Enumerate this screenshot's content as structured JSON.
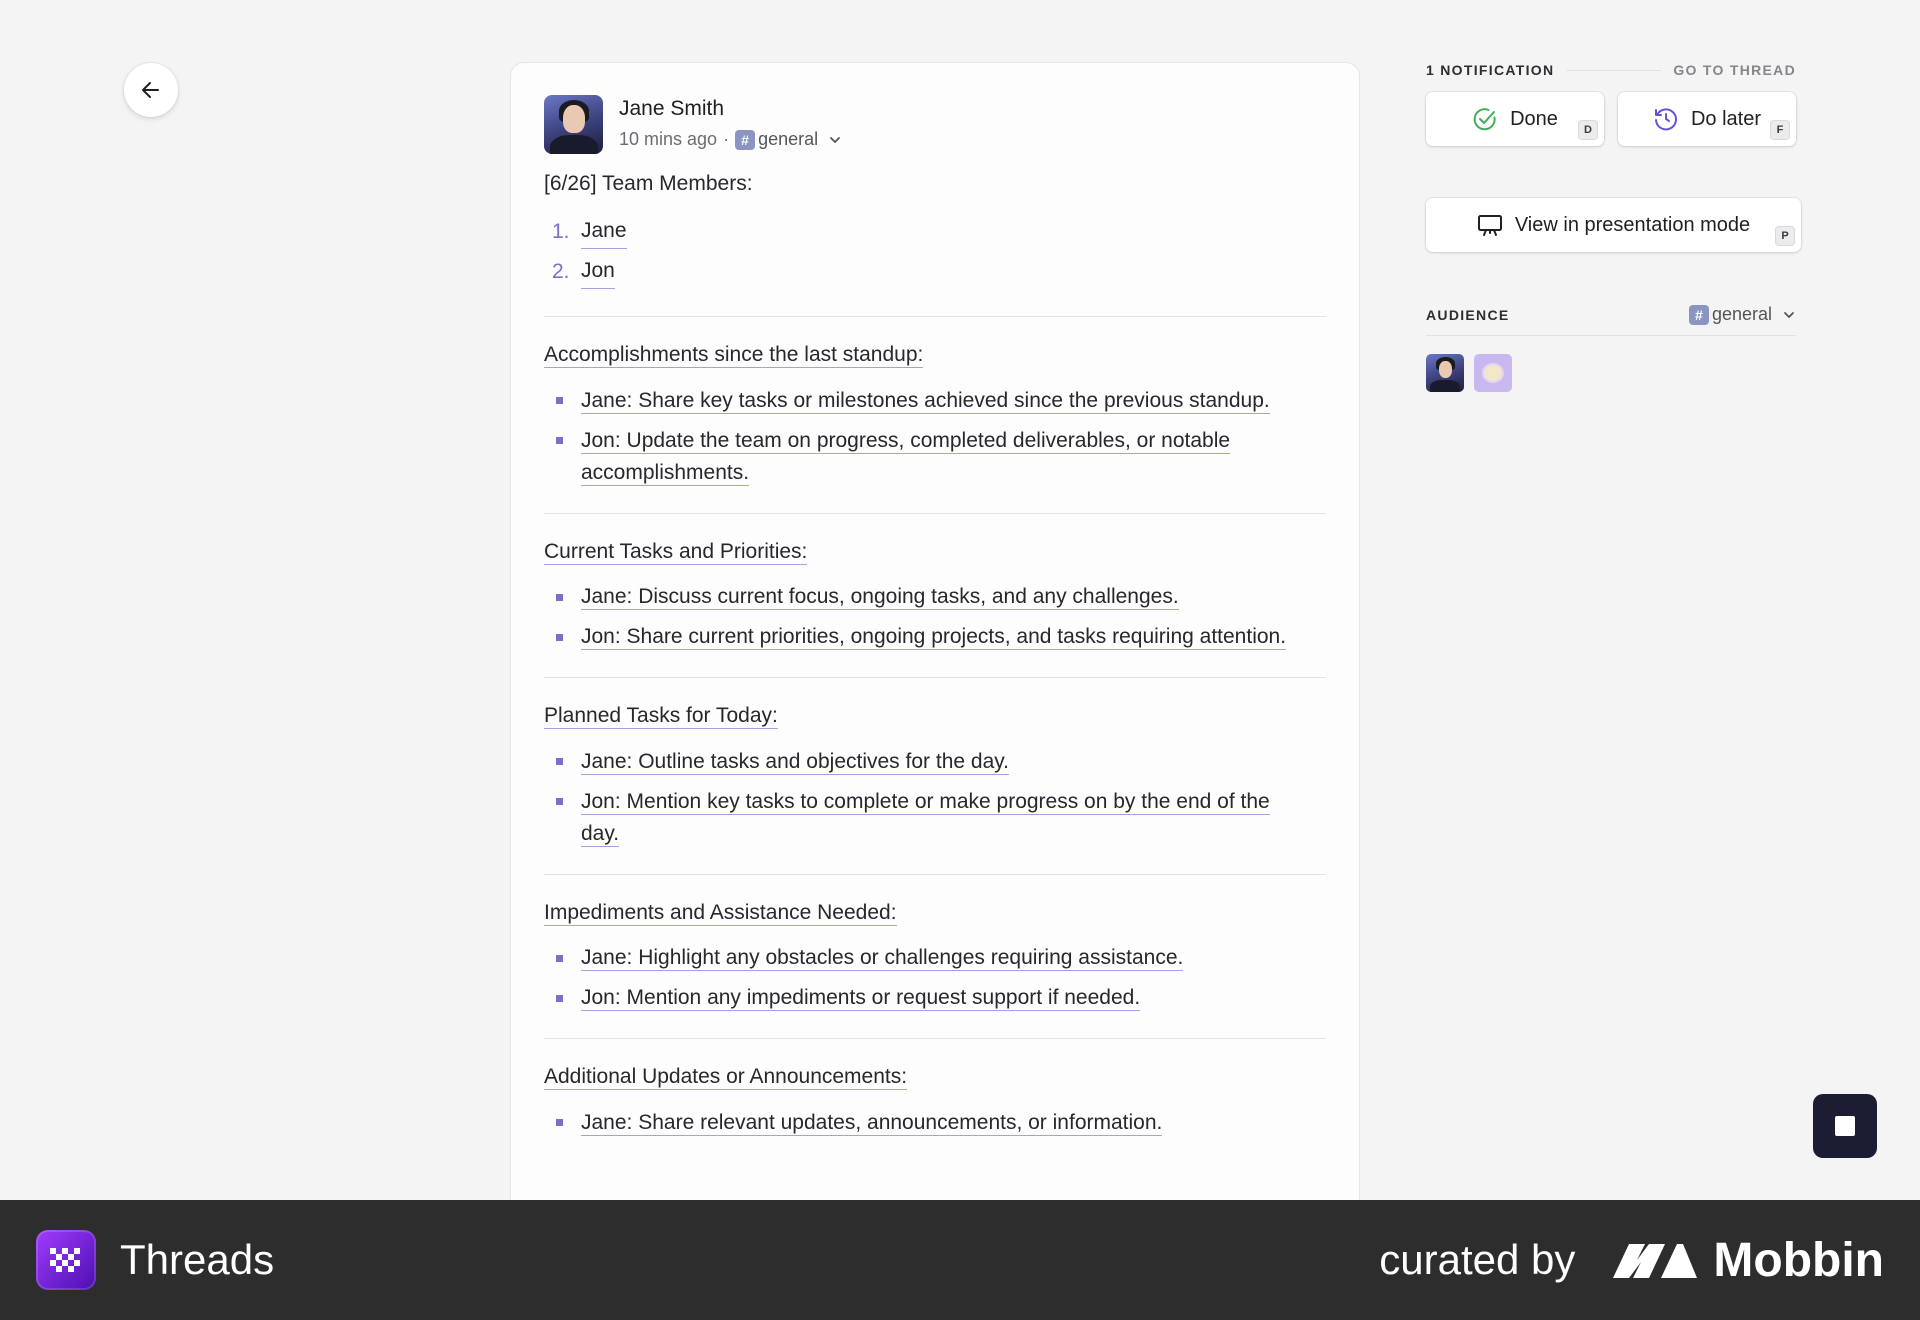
{
  "post": {
    "author": "Jane Smith",
    "time": "10 mins ago",
    "separator": "·",
    "channel": "general",
    "intro": "[6/26] Team Members:",
    "members": [
      {
        "num": "1.",
        "name": "Jane"
      },
      {
        "num": "2.",
        "name": "Jon"
      }
    ],
    "sections": [
      {
        "title": "Accomplishments since the last standup:",
        "items": [
          "Jane: Share key tasks or milestones achieved since the previous standup.",
          "Jon: Update the team on progress, completed deliverables, or notable accomplishments."
        ]
      },
      {
        "title": "Current Tasks and Priorities:",
        "items": [
          "Jane: Discuss current focus, ongoing tasks, and any challenges.",
          "Jon: Share current priorities, ongoing projects, and tasks requiring attention."
        ]
      },
      {
        "title": "Planned Tasks for Today:",
        "items": [
          "Jane: Outline tasks and objectives for the day.",
          "Jon: Mention key tasks to complete or make progress on by the end of the day."
        ]
      },
      {
        "title": "Impediments and Assistance Needed:",
        "items": [
          "Jane: Highlight any obstacles or challenges requiring assistance.",
          "Jon: Mention any impediments or request support if needed."
        ]
      },
      {
        "title": "Additional Updates or Announcements:",
        "items": [
          "Jane: Share relevant updates, announcements, or information."
        ]
      }
    ]
  },
  "panel": {
    "notification_label": "1 NOTIFICATION",
    "goto_label": "GO TO THREAD",
    "done_label": "Done",
    "done_key": "D",
    "later_label": "Do later",
    "later_key": "F",
    "presentation_label": "View in presentation mode",
    "presentation_key": "P",
    "audience_label": "AUDIENCE",
    "audience_channel": "general"
  },
  "footer": {
    "app_name": "Threads",
    "curated": "curated by",
    "brand": "Mobbin"
  },
  "colors": {
    "accent": "#7c6fc7",
    "done_green": "#3fae5a",
    "later_purple": "#6a4fd8",
    "footer_bg": "#2d2d2d"
  },
  "icons": [
    "arrow-left-icon",
    "check-circle-icon",
    "clock-rewind-icon",
    "presentation-icon",
    "chevron-down-icon",
    "hash-icon",
    "stop-icon"
  ]
}
